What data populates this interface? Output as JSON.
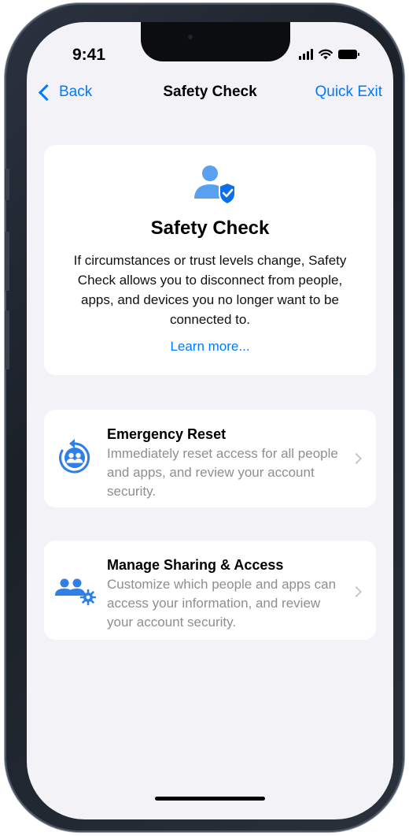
{
  "status_bar": {
    "time": "9:41"
  },
  "nav": {
    "back_label": "Back",
    "title": "Safety Check",
    "exit_label": "Quick Exit"
  },
  "hero": {
    "icon": "person-shield-icon",
    "title": "Safety Check",
    "description": "If circumstances or trust levels change, Safety Check allows you to disconnect from people, apps, and devices you no longer want to be connected to.",
    "link": "Learn more..."
  },
  "options": [
    {
      "icon": "emergency-reset-icon",
      "title": "Emergency Reset",
      "subtitle": "Immediately reset access for all people and apps, and review your account security."
    },
    {
      "icon": "manage-sharing-icon",
      "title": "Manage Sharing & Access",
      "subtitle": "Customize which people and apps can access your information, and review your account security."
    }
  ],
  "colors": {
    "accent": "#007aff",
    "background": "#f2f2f7",
    "card": "#ffffff",
    "secondary_text": "#8e8e93"
  }
}
